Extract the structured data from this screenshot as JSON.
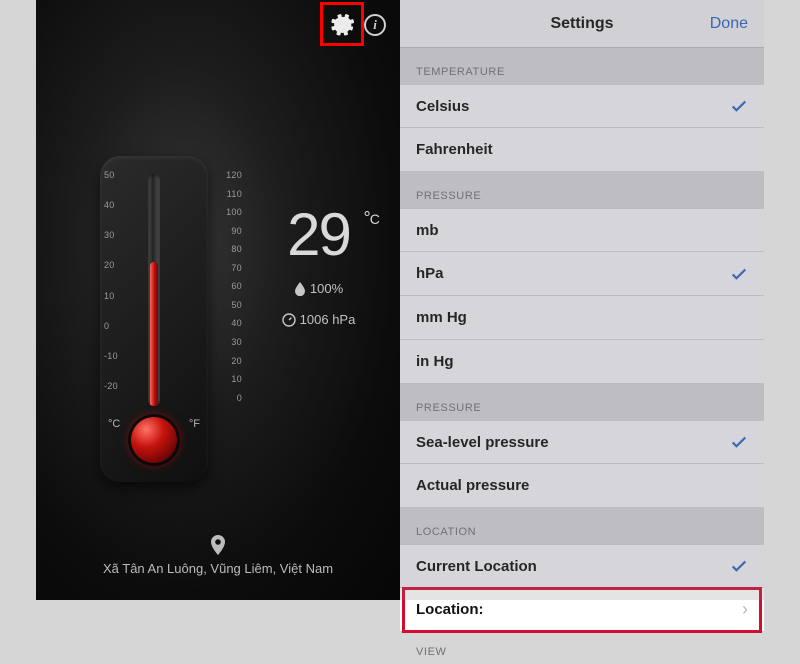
{
  "left": {
    "temperature_value": "29",
    "temperature_unit": "C",
    "humidity": "100%",
    "pressure": "1006 hPa",
    "location": "Xã Tân An Luông, Vũng Liêm, Việt Nam",
    "scale_c_label": "°C",
    "scale_f_label": "°F",
    "ticks_c": [
      "50",
      "40",
      "30",
      "20",
      "10",
      "0",
      "-10",
      "-20"
    ],
    "ticks_f": [
      "120",
      "110",
      "100",
      "90",
      "80",
      "70",
      "60",
      "50",
      "40",
      "30",
      "20",
      "10",
      "0"
    ]
  },
  "right": {
    "title": "Settings",
    "done": "Done",
    "sections": {
      "temperature": {
        "header": "TEMPERATURE",
        "celsius": "Celsius",
        "fahrenheit": "Fahrenheit"
      },
      "pressure_unit": {
        "header": "PRESSURE",
        "mb": "mb",
        "hpa": "hPa",
        "mmhg": "mm Hg",
        "inhg": "in Hg"
      },
      "pressure_ref": {
        "header": "PRESSURE",
        "sea": "Sea-level pressure",
        "actual": "Actual pressure"
      },
      "location": {
        "header": "LOCATION",
        "current": "Current Location",
        "manual": "Location:"
      },
      "view": {
        "header": "VIEW"
      }
    }
  }
}
